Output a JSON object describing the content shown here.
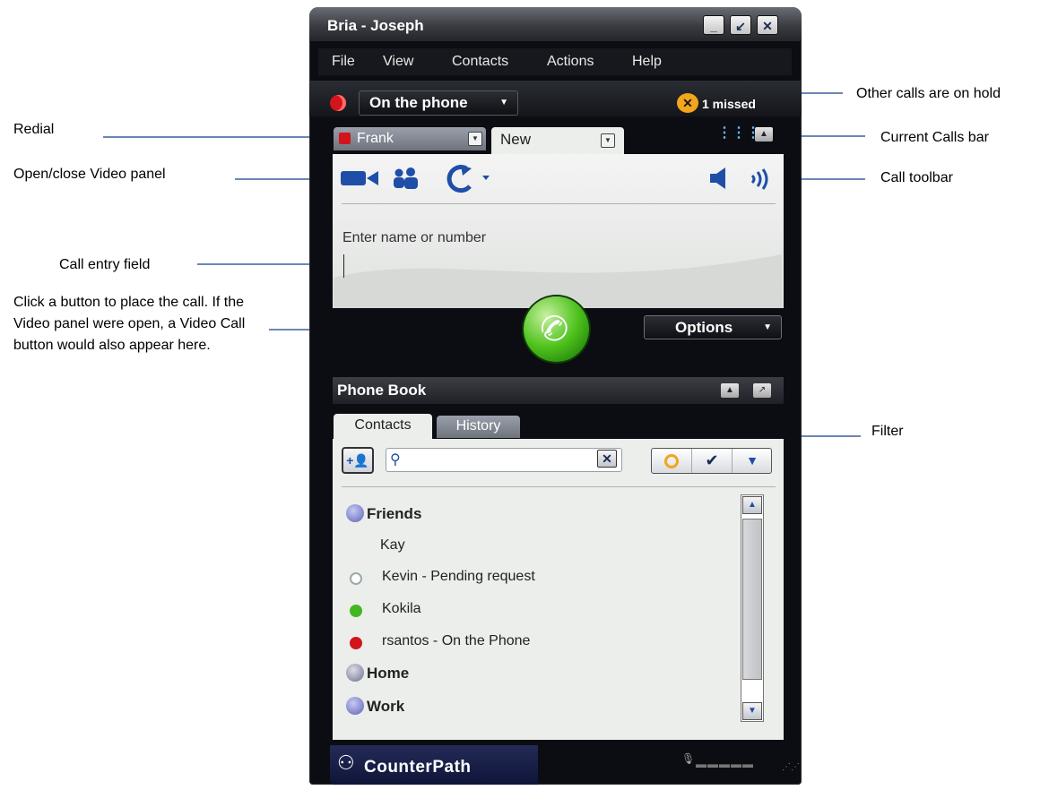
{
  "window": {
    "title": "Bria - Joseph",
    "title_buttons": [
      "_",
      "↙",
      "✕"
    ]
  },
  "menu": [
    "File",
    "View",
    "Contacts",
    "Actions",
    "Help"
  ],
  "status": {
    "value": "On the phone",
    "missed_label": "1 missed"
  },
  "call_tabs": {
    "on_hold": "Frank",
    "current": "New"
  },
  "call_entry": {
    "placeholder": "Enter name or number"
  },
  "options_label": "Options",
  "phone_book": {
    "title": "Phone Book",
    "tabs": [
      "Contacts",
      "History"
    ],
    "groups": [
      {
        "name": "Friends",
        "contacts": [
          {
            "name": "Kay",
            "status": "none"
          },
          {
            "name": "Kevin - Pending request",
            "status": "pending"
          },
          {
            "name": "Kokila",
            "status": "online"
          },
          {
            "name": "rsantos - On the Phone",
            "status": "on-phone"
          }
        ]
      },
      {
        "name": "Home",
        "contacts": []
      },
      {
        "name": "Work",
        "contacts": []
      }
    ]
  },
  "footer": {
    "brand": "CounterPath"
  },
  "annotations": {
    "other_calls": "Other calls are on hold",
    "redial": "Redial",
    "current_calls": "Current Calls bar",
    "video_panel": "Open/close Video panel",
    "call_toolbar": "Call toolbar",
    "entry_field": "Call entry field",
    "place_call": "Click a button to place the call. If the Video panel were open, a Video Call button would also appear here.",
    "filter": "Filter"
  },
  "colors": {
    "window_bg": "#0b0d12",
    "accent_blue": "#1f4ea8",
    "call_green": "#4fc21d",
    "status_red": "#d2141c",
    "missed_orange": "#f3a51c"
  },
  "icons": {
    "video": "video-camera-icon",
    "conference": "conference-icon",
    "redial": "redial-icon",
    "speaker": "speaker-icon",
    "volume": "volume-waves-icon",
    "add_contact": "add-contact-icon",
    "search": "search-icon"
  }
}
